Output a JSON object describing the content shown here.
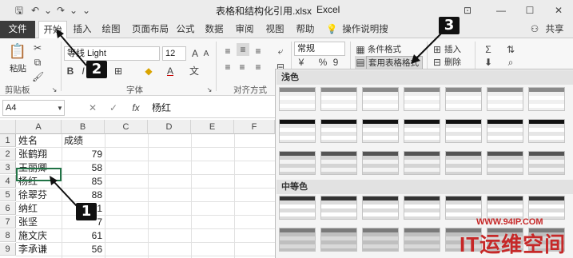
{
  "titlebar": {
    "filename": "表格和结构化引用.xlsx",
    "app": "Excel",
    "qat": {
      "save": "🖫",
      "undo": "↶",
      "redo": "↷",
      "more": "⌄"
    },
    "controls": {
      "ribbon_display": "⊡",
      "minimize": "—",
      "restore": "☐",
      "close": "✕"
    }
  },
  "tabs": [
    "文件",
    "开始",
    "插入",
    "绘图",
    "页面布局",
    "公式",
    "数据",
    "审阅",
    "视图",
    "帮助",
    "操作说明搜索"
  ],
  "tell_me_icon": "lightbulb-icon",
  "share": {
    "label": "共享",
    "icon": "person-icon"
  },
  "ribbon": {
    "clipboard": {
      "paste": "粘贴",
      "label": "剪贴板"
    },
    "font": {
      "name": "等线 Light",
      "size": "12",
      "label": "字体",
      "bold": "B"
    },
    "alignment": {
      "label": "对齐方式"
    },
    "number": {
      "format": "常规",
      "percent": "%",
      "comma": "9"
    },
    "styles": {
      "conditional": "条件格式",
      "format_as_table": "套用表格格式"
    },
    "cells": {
      "insert": "插入",
      "delete": "删除"
    },
    "editing": {
      "sum": "Σ"
    }
  },
  "formula_bar": {
    "name_box": "A4",
    "cancel": "✕",
    "enter": "✓",
    "fx": "fx",
    "content": "杨红"
  },
  "columns": [
    "A",
    "B",
    "C",
    "D",
    "E",
    "F"
  ],
  "rows": [
    {
      "num": "1",
      "a": "姓名",
      "b": "成绩"
    },
    {
      "num": "2",
      "a": "张鹤翔",
      "b": "79"
    },
    {
      "num": "3",
      "a": "王丽卿",
      "b": "58"
    },
    {
      "num": "4",
      "a": "杨红",
      "b": "85"
    },
    {
      "num": "5",
      "a": "徐翠芬",
      "b": "88"
    },
    {
      "num": "6",
      "a": "纳红",
      "b": "71"
    },
    {
      "num": "7",
      "a": "张坚",
      "b": "7"
    },
    {
      "num": "8",
      "a": "施文庆",
      "b": "61"
    },
    {
      "num": "9",
      "a": "李承谦",
      "b": "56"
    }
  ],
  "gallery": {
    "light": "浅色",
    "medium": "中等色"
  },
  "callouts": [
    "1",
    "2",
    "3"
  ],
  "watermark": {
    "url": "WWW.94IP.COM",
    "brand": "IT运维空间"
  },
  "colors": {
    "file_tab": "#3b3b3b",
    "selection": "#217346",
    "callout": "#111111",
    "watermark": "#c62828"
  }
}
